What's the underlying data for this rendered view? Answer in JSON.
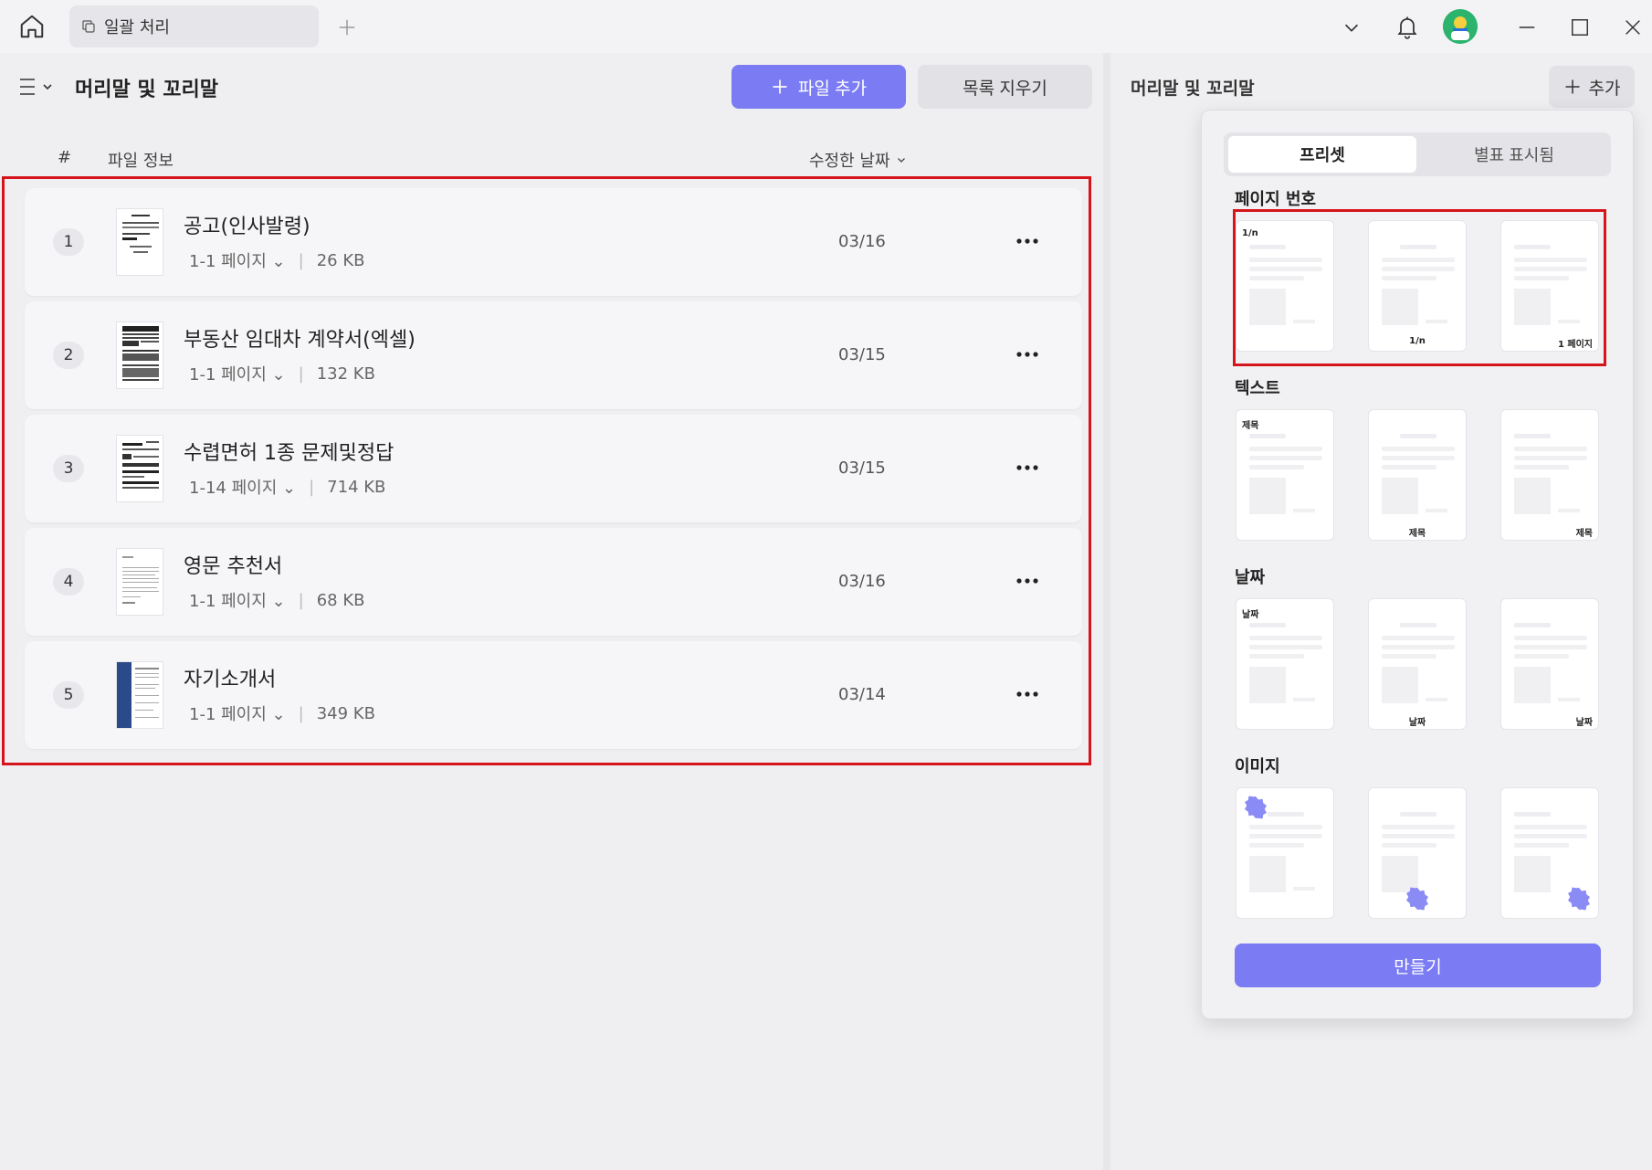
{
  "titlebar": {
    "tab_label": "일괄 처리"
  },
  "main": {
    "title": "머리말 및 꼬리말",
    "add_file_label": "파일 추가",
    "clear_list_label": "목록 지우기",
    "columns": {
      "num": "#",
      "info": "파일 정보",
      "date": "수정한 날짜"
    },
    "files": [
      {
        "num": "1",
        "name": "공고(인사발령)",
        "pages": "1-1 페이지",
        "size": "26 KB",
        "date": "03/16"
      },
      {
        "num": "2",
        "name": "부동산 임대차 계약서(엑셀)",
        "pages": "1-1 페이지",
        "size": "132 KB",
        "date": "03/15"
      },
      {
        "num": "3",
        "name": "수렵면허 1종 문제및정답",
        "pages": "1-14 페이지",
        "size": "714 KB",
        "date": "03/15"
      },
      {
        "num": "4",
        "name": "영문 추천서",
        "pages": "1-1 페이지",
        "size": "68 KB",
        "date": "03/16"
      },
      {
        "num": "5",
        "name": "자기소개서",
        "pages": "1-1 페이지",
        "size": "349 KB",
        "date": "03/14"
      }
    ]
  },
  "right": {
    "title": "머리말 및 꼬리말",
    "add_label": "추가",
    "segments": {
      "preset": "프리셋",
      "marked": "별표 표시됨"
    },
    "sections": {
      "page_number": {
        "title": "페이지 번호",
        "labels": [
          "1/n",
          "1/n",
          "1 페이지"
        ]
      },
      "text": {
        "title": "텍스트",
        "labels": [
          "제목",
          "제목",
          "제목"
        ]
      },
      "date": {
        "title": "날짜",
        "labels": [
          "날짜",
          "날짜",
          "날짜"
        ]
      },
      "image": {
        "title": "이미지"
      }
    },
    "create_label": "만들기"
  },
  "colors": {
    "accent": "#7b7bf3",
    "highlight": "#d6141b",
    "badge": "#8b8bf5"
  }
}
